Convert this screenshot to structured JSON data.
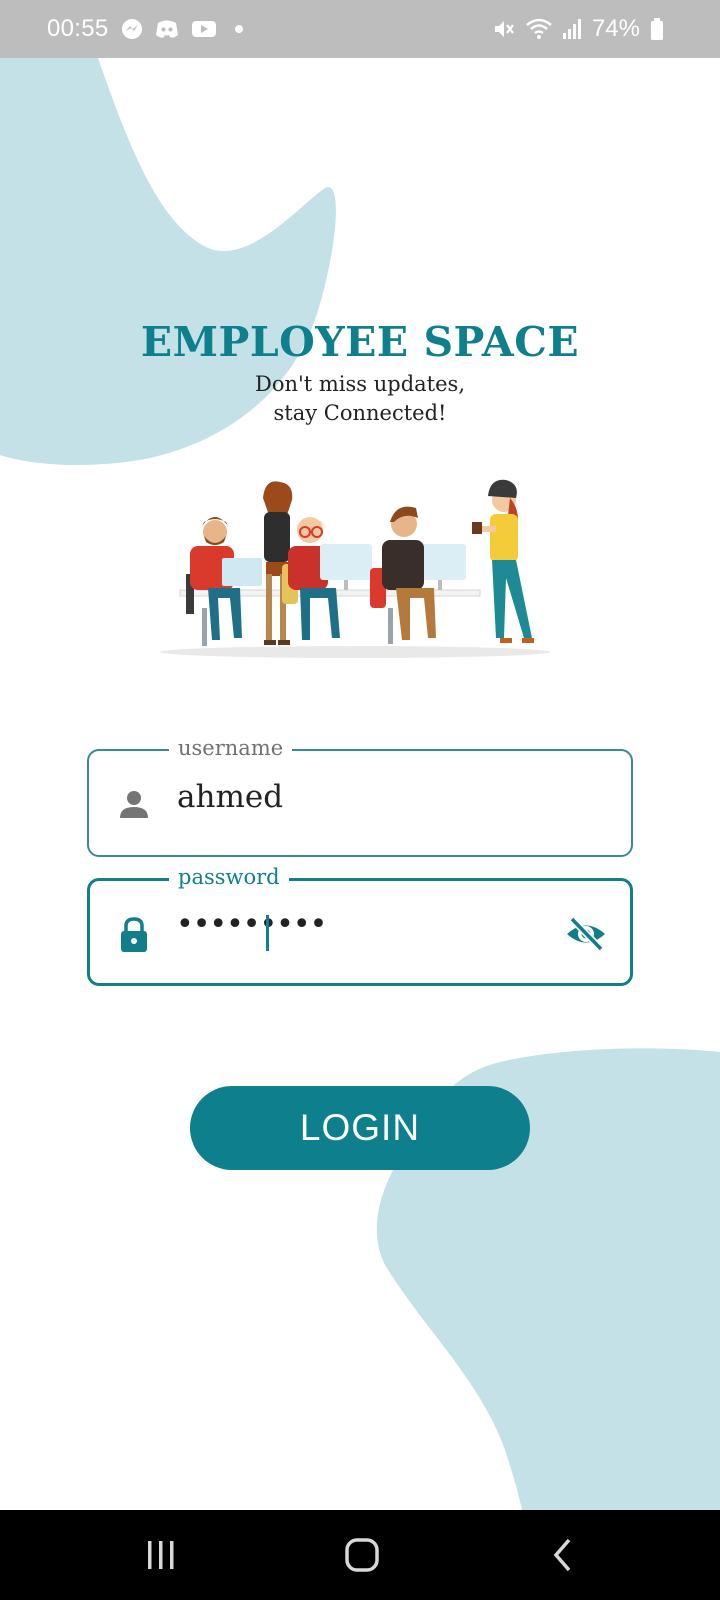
{
  "status_bar": {
    "time": "00:55",
    "battery": "74%",
    "left_icons": [
      "messenger-icon",
      "discord-icon",
      "youtube-icon",
      "dot-icon"
    ],
    "right_icons": [
      "mute-icon",
      "wifi-icon",
      "signal-icon",
      "battery-icon"
    ]
  },
  "header": {
    "title": "EMPLOYEE SPACE",
    "subtitle_line1": "Don't miss updates,",
    "subtitle_line2": "stay Connected!"
  },
  "form": {
    "username": {
      "label": "username",
      "value": "ahmed",
      "icon": "person-icon"
    },
    "password": {
      "label": "password",
      "value": "•••••••••",
      "icon": "lock-icon",
      "toggle_icon": "eye-off-icon"
    },
    "login_label": "LOGIN"
  },
  "nav_bar": {
    "items": [
      "recents-icon",
      "home-icon",
      "back-icon"
    ]
  },
  "colors": {
    "accent": "#0e7f8c",
    "blob": "#c3e1e6",
    "status_bar": "#bdbdbd",
    "nav_bar": "#000000"
  }
}
